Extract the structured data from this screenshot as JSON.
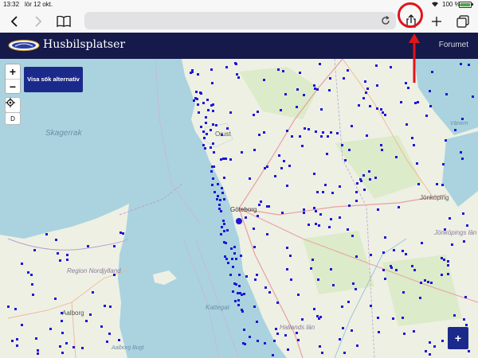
{
  "status_bar": {
    "time": "13:32",
    "date": "lör 12 okt.",
    "battery_percent": "100 %",
    "battery_level": 1.0
  },
  "browser": {
    "buttons": [
      "back",
      "forward",
      "bookmarks",
      "reload",
      "share",
      "new-tab",
      "tabs"
    ]
  },
  "site": {
    "title": "Husbilsplatser",
    "forum_link": "Forumet"
  },
  "map": {
    "zoom_in": "+",
    "zoom_out": "−",
    "layer_label": "D",
    "search_button": "Visa sök alternativ",
    "add_button": "+",
    "labels": {
      "skagerrak": "Skagerrak",
      "kattegat": "Kattegat",
      "orust": "Orust",
      "goteborg": "Göteborg",
      "region_nordjylland": "Region Nordjylland",
      "aalborg": "Aalborg",
      "aalborg_bugt": "Aalborg Bugt",
      "jonkoping": "Jönköping",
      "hallands_lan": "Hallands län",
      "jonkopings_lan": "Jönköpings län",
      "vanern": "Vänern"
    }
  },
  "colors": {
    "header": "#151a4a",
    "accent": "#1b2a8a",
    "marker": "#1f16d6",
    "highlight": "#e0141b"
  }
}
